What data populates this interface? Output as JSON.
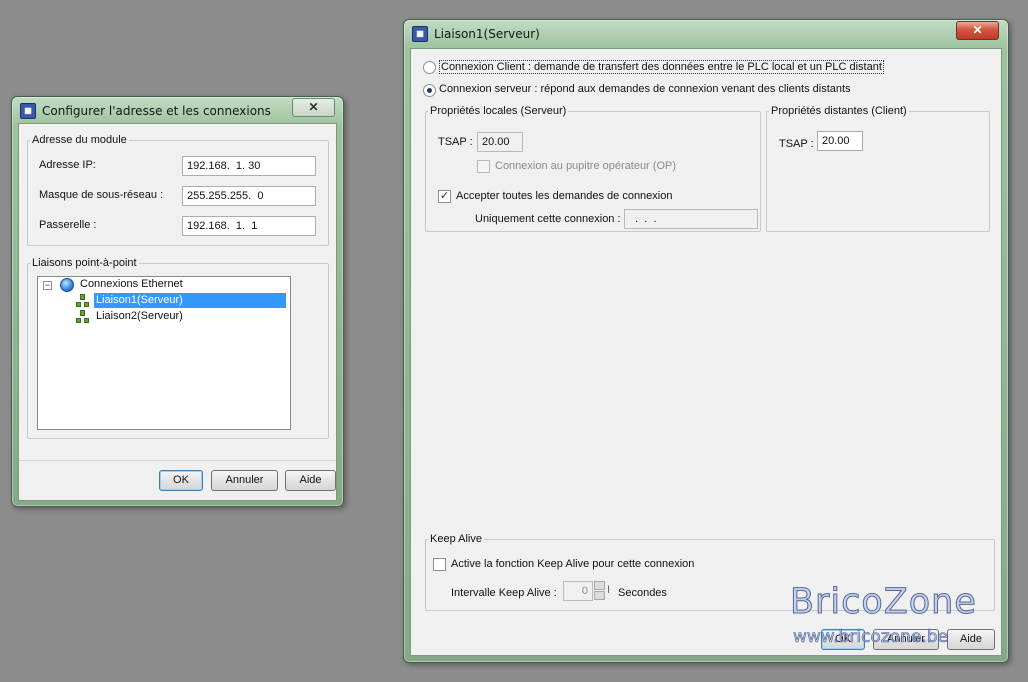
{
  "dialog1": {
    "title": "Configurer l'adresse et les connexions",
    "close_label": "✕",
    "module_group": {
      "legend": "Adresse du module",
      "ip_label": "Adresse IP:",
      "ip_value": "192.168.  1. 30",
      "mask_label": "Masque de sous-réseau :",
      "mask_value": "255.255.255.  0",
      "gateway_label": "Passerelle :",
      "gateway_value": "192.168.  1.  1"
    },
    "links_group": {
      "legend": "Liaisons point-à-point",
      "tree": {
        "root": {
          "label": "Connexions Ethernet",
          "expander": "−",
          "icon": "globe-icon"
        },
        "children": [
          {
            "label": "Liaison1(Serveur)",
            "selected": true,
            "icon": "network-link-icon"
          },
          {
            "label": "Liaison2(Serveur)",
            "selected": false,
            "icon": "network-link-icon"
          }
        ]
      }
    },
    "buttons": {
      "ok": "OK",
      "cancel": "Annuler",
      "help": "Aide"
    }
  },
  "dialog2": {
    "title": "Liaison1(Serveur)",
    "close_label": "✕",
    "mode": {
      "client_label": "Connexion Client : demande de transfert des données entre le PLC local et un PLC distant",
      "server_label": "Connexion serveur : répond aux demandes de connexion venant des clients distants",
      "selected": "server"
    },
    "local": {
      "legend": "Propriétés locales (Serveur)",
      "tsap_label": "TSAP :",
      "tsap_value": "20.00",
      "op_label": "Connexion au pupitre opérateur (OP)",
      "op_checked": false,
      "accept_label": "Accepter toutes les demandes de connexion",
      "accept_checked": true,
      "only_label": "Uniquement cette connexion :",
      "only_value": "  .  .  ."
    },
    "remote": {
      "legend": "Propriétés distantes (Client)",
      "tsap_label": "TSAP :",
      "tsap_value": "20.00"
    },
    "keepalive": {
      "legend": "Keep Alive",
      "enable_label": "Active la fonction Keep Alive pour cette connexion",
      "enable_checked": false,
      "interval_label": "Intervalle Keep Alive :",
      "interval_value": "0",
      "interval_unit": "Secondes"
    },
    "buttons": {
      "ok": "OK",
      "cancel": "Annuler",
      "help": "Aide"
    }
  },
  "watermark": {
    "brand": "BricoZone",
    "url": "www.bricozone.be"
  },
  "colors": {
    "window_frame": "#9fc39f",
    "close_red": "#c0392b",
    "selection": "#3399ff",
    "desktop": "#8d8d8d"
  }
}
